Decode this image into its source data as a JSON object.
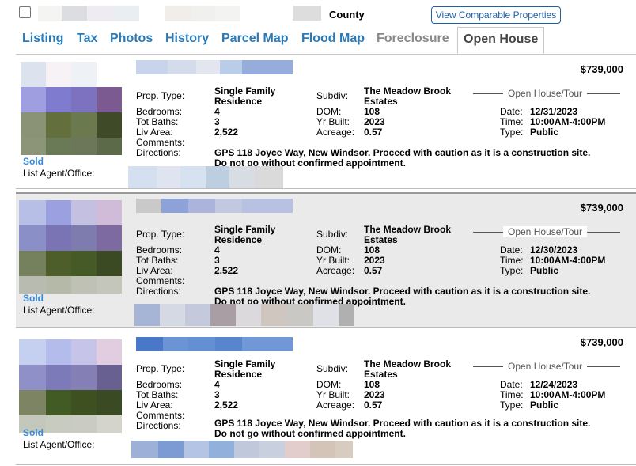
{
  "header": {
    "county_label": "County",
    "comparable_button": "View Comparable Properties"
  },
  "tabs": [
    {
      "label": "Listing",
      "state": "normal"
    },
    {
      "label": "Tax",
      "state": "normal"
    },
    {
      "label": "Photos",
      "state": "normal"
    },
    {
      "label": "History",
      "state": "normal"
    },
    {
      "label": "Parcel Map",
      "state": "normal"
    },
    {
      "label": "Flood Map",
      "state": "normal"
    },
    {
      "label": "Foreclosure",
      "state": "disabled"
    },
    {
      "label": "Open House",
      "state": "active"
    }
  ],
  "labels": {
    "prop_type": "Prop. Type:",
    "bedrooms": "Bedrooms:",
    "tot_baths": "Tot Baths:",
    "liv_area": "Liv Area:",
    "comments": "Comments:",
    "directions": "Directions:",
    "subdiv": "Subdiv:",
    "dom": "DOM:",
    "yr_built": "Yr Built:",
    "acreage": "Acreage:",
    "date": "Date:",
    "time": "Time:",
    "type": "Type:",
    "open_house_title": "Open House/Tour",
    "list_agent": "List Agent/Office:"
  },
  "listings": [
    {
      "address": "118 Joyce Way, New Windsor",
      "price": "$739,000",
      "status": "Sold",
      "prop_type_line1": "Single Family",
      "prop_type_line2": "Residence",
      "bedrooms": "4",
      "tot_baths": "3",
      "liv_area": "2,522",
      "subdiv_line1": "The Meadow Brook",
      "subdiv_line2": "Estates",
      "dom": "108",
      "yr_built": "2023",
      "acreage": "0.57",
      "oh_date": "12/31/2023",
      "oh_time": "10:00AM-4:00PM",
      "oh_type": "Public",
      "directions_line1": "GPS 118 Joyce Way, New Windsor. Proceed with caution as it is a construction site.",
      "directions_line2": "Do not go without confirmed appointment."
    },
    {
      "address": "118 Joyce Way, New Windsor",
      "price": "$739,000",
      "status": "Sold",
      "prop_type_line1": "Single Family",
      "prop_type_line2": "Residence",
      "bedrooms": "4",
      "tot_baths": "3",
      "liv_area": "2,522",
      "subdiv_line1": "The Meadow Brook",
      "subdiv_line2": "Estates",
      "dom": "108",
      "yr_built": "2023",
      "acreage": "0.57",
      "oh_date": "12/30/2023",
      "oh_time": "10:00AM-4:00PM",
      "oh_type": "Public",
      "directions_line1": "GPS 118 Joyce Way, New Windsor. Proceed with caution as it is a construction site.",
      "directions_line2": "Do not go without confirmed appointment."
    },
    {
      "address": "118 Joyce Way, New Windsor",
      "price": "$739,000",
      "status": "Sold",
      "prop_type_line1": "Single Family",
      "prop_type_line2": "Residence",
      "bedrooms": "4",
      "tot_baths": "3",
      "liv_area": "2,522",
      "subdiv_line1": "The Meadow Brook",
      "subdiv_line2": "Estates",
      "dom": "108",
      "yr_built": "2023",
      "acreage": "0.57",
      "oh_date": "12/24/2023",
      "oh_time": "10:00AM-4:00PM",
      "oh_type": "Public",
      "directions_line1": "GPS 118 Joyce Way, New Windsor. Proceed with caution as it is a construction site.",
      "directions_line2": "Do not go without confirmed appointment."
    }
  ]
}
